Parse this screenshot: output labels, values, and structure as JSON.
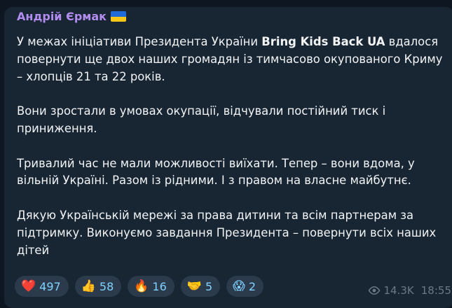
{
  "message": {
    "author": "Андрій Єрмак",
    "author_flag": "ukraine-flag",
    "paragraphs": [
      {
        "parts": [
          {
            "text": "У межах ініціативи Президента України ",
            "bold": false
          },
          {
            "text": "Bring Kids Back UA",
            "bold": true
          },
          {
            "text": " вдалося повернути ще двох наших громадян із тимчасово окупованого Криму – хлопців 21 та 22 років.",
            "bold": false
          }
        ]
      },
      {
        "parts": [
          {
            "text": "Вони зростали в умовах окупації, відчували постійний тиск і приниження.",
            "bold": false
          }
        ]
      },
      {
        "parts": [
          {
            "text": "Тривалий час не мали можливості виїхати. Тепер – вони вдома, у вільній Україні. Разом із рідними. І з правом на власне майбутнє.",
            "bold": false
          }
        ]
      },
      {
        "parts": [
          {
            "text": "Дякую Українській мережі за права дитини та всім партнерам за підтримку. Виконуємо завдання Президента – повернути всіх наших дітей",
            "bold": false
          }
        ]
      }
    ],
    "reactions": [
      {
        "emoji": "❤️",
        "icon": "heart-icon",
        "count": "497"
      },
      {
        "emoji": "👍",
        "icon": "thumbs-up-icon",
        "count": "58"
      },
      {
        "emoji": "🔥",
        "icon": "fire-icon",
        "count": "16"
      },
      {
        "emoji": "🤝",
        "icon": "handshake-icon",
        "count": "5"
      },
      {
        "emoji": "😱",
        "icon": "scream-face-icon",
        "count": "2"
      }
    ],
    "views": "14.3K",
    "time": "18:55"
  },
  "colors": {
    "background": "#0e1621",
    "bubble": "#182533",
    "author": "#b38cf0",
    "text": "#f2f4f6",
    "reaction_bg": "#2b3b4c",
    "reaction_text": "#7fd1ff",
    "meta": "#6c7883"
  }
}
